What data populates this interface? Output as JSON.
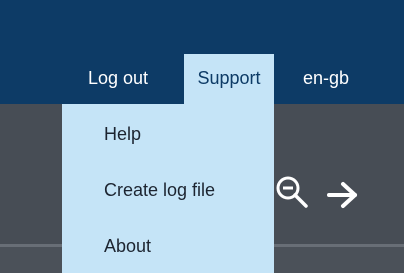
{
  "header": {
    "nav": [
      {
        "label": "Log out"
      },
      {
        "label": "Support"
      },
      {
        "label": "en-gb"
      }
    ]
  },
  "support_menu": {
    "items": [
      {
        "label": "Help"
      },
      {
        "label": "Create log file"
      },
      {
        "label": "About"
      }
    ]
  },
  "toolbar": {
    "icons": [
      "zoom-out-icon",
      "arrow-right-icon"
    ]
  },
  "colors": {
    "header_bg": "#0d3b66",
    "menu_bg": "#c5e4f7",
    "toolbar_bg": "#474d55"
  }
}
